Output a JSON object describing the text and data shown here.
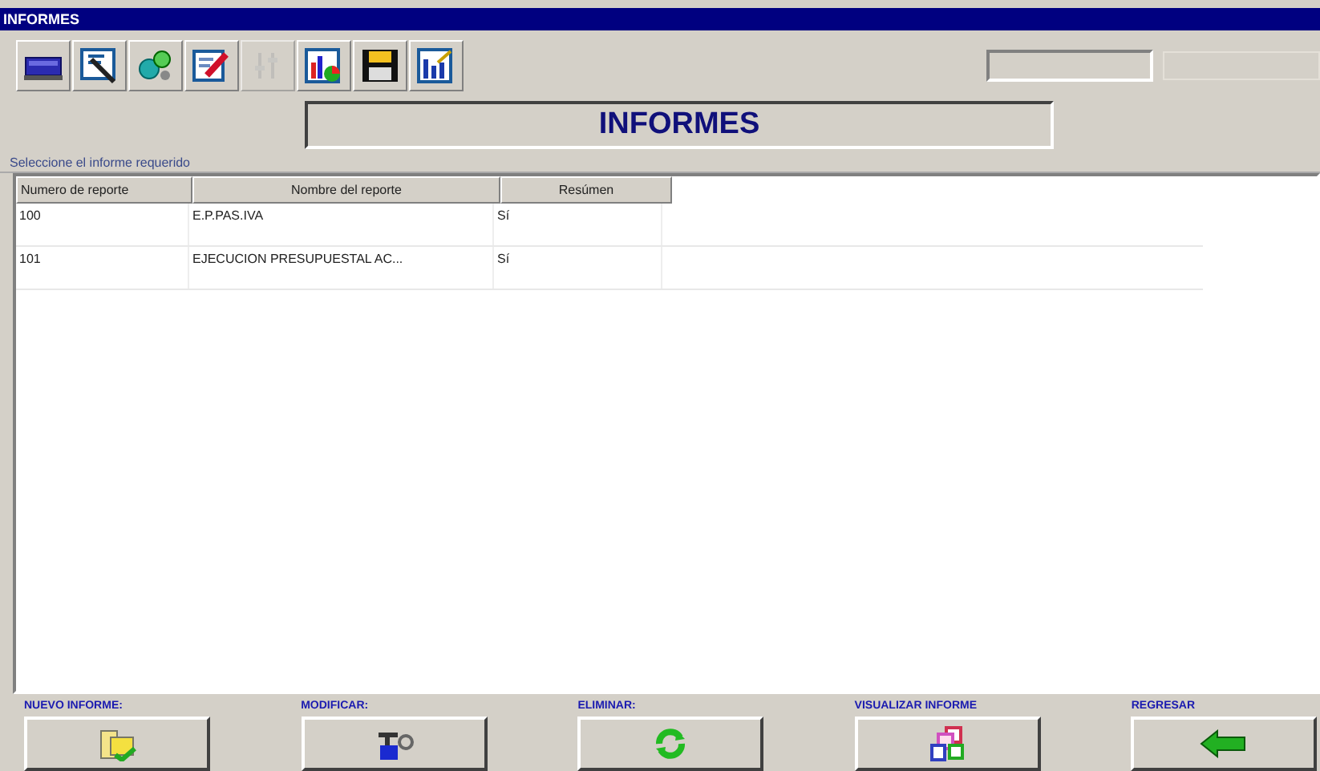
{
  "window": {
    "title": "INFORMES"
  },
  "toolbar": [
    {
      "kind": "device",
      "disabled": false
    },
    {
      "kind": "tools",
      "disabled": false
    },
    {
      "kind": "gears",
      "disabled": false
    },
    {
      "kind": "edit",
      "disabled": false
    },
    {
      "kind": "levels",
      "disabled": true
    },
    {
      "kind": "chart",
      "disabled": false
    },
    {
      "kind": "save",
      "disabled": false
    },
    {
      "kind": "bars",
      "disabled": false
    }
  ],
  "header": {
    "title": "INFORMES"
  },
  "group": {
    "label": "Seleccione el informe requerido"
  },
  "table": {
    "columns": [
      "Numero de reporte",
      "Nombre del reporte",
      "Resúmen"
    ],
    "rows": [
      [
        "100",
        "E.P.PAS.IVA",
        "Sí"
      ],
      [
        "101",
        "EJECUCION PRESUPUESTAL AC...",
        "Sí"
      ]
    ]
  },
  "actions": [
    {
      "label": "NUEVO INFORME:",
      "kind": "new"
    },
    {
      "label": "MODIFICAR:",
      "kind": "modify"
    },
    {
      "label": "ELIMINAR:",
      "kind": "delete"
    },
    {
      "label": "VISUALIZAR INFORME",
      "kind": "view"
    },
    {
      "label": "REGRESAR",
      "kind": "back"
    }
  ]
}
